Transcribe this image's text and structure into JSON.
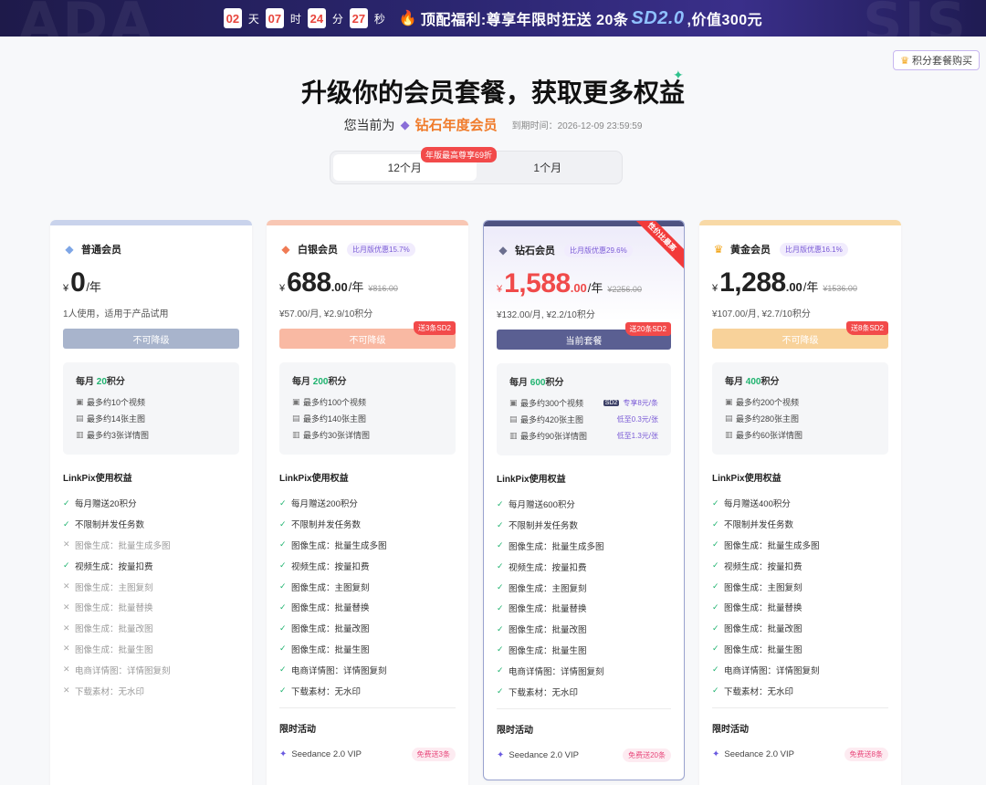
{
  "banner": {
    "countdown": [
      {
        "value": "02",
        "unit": "天"
      },
      {
        "value": "07",
        "unit": "时"
      },
      {
        "value": "24",
        "unit": "分"
      },
      {
        "value": "27",
        "unit": "秒"
      }
    ],
    "fire_icon": "fire-icon",
    "text_before": "顶配福利:尊享年限时狂送 20条",
    "highlight": "SD2.0",
    "text_after": ",价值300元"
  },
  "header": {
    "package_button": "积分套餐购买",
    "title": "升级你的会员套餐，获取更多权益",
    "current_label": "您当前为",
    "current_tier": "钻石年度会员",
    "expire": "到期时间：2026-12-09 23:59:59"
  },
  "period_tabs": {
    "items": [
      {
        "label": "12个月",
        "active": true
      },
      {
        "label": "1个月",
        "active": false
      }
    ],
    "hot_badge": "年版最高尊享69折"
  },
  "plans": [
    {
      "name": "普通会员",
      "icon": "gem-icon",
      "icon_color": "#7ea6e6",
      "discount": "",
      "currency": "¥",
      "price_int": "0",
      "price_dec": "",
      "per": "/年",
      "orig": "",
      "sub": "1人使用，适用于产品试用",
      "cta": "不可降级",
      "gift": "",
      "credits_prefix": "每月",
      "credits_num": "20",
      "credits_suffix": "积分",
      "quotas": [
        {
          "icon": "video-icon",
          "text": "最多约10个视频",
          "note": ""
        },
        {
          "icon": "image-icon",
          "text": "最多约14张主图",
          "note": ""
        },
        {
          "icon": "detail-icon",
          "text": "最多约3张详情图",
          "note": ""
        }
      ],
      "benefits_title": "LinkPix使用权益",
      "benefits": [
        {
          "text": "每月赠送20积分",
          "ok": true
        },
        {
          "text": "不限制并发任务数",
          "ok": true
        },
        {
          "text": "图像生成：批量生成多图",
          "ok": false
        },
        {
          "text": "视频生成：按量扣费",
          "ok": true
        },
        {
          "text": "图像生成：主图复刻",
          "ok": false
        },
        {
          "text": "图像生成：批量替换",
          "ok": false
        },
        {
          "text": "图像生成：批量改图",
          "ok": false
        },
        {
          "text": "图像生成：批量生图",
          "ok": false
        },
        {
          "text": "电商详情图：详情图复刻",
          "ok": false
        },
        {
          "text": "下载素材：无水印",
          "ok": false
        }
      ],
      "limited_title": "",
      "limited_item": "",
      "limited_badge": ""
    },
    {
      "name": "白银会员",
      "icon": "gem-icon",
      "icon_color": "#f07b55",
      "discount": "比月版优惠15.7%",
      "currency": "¥",
      "price_int": "688",
      "price_dec": ".00",
      "per": "/年",
      "orig": "¥816.00",
      "sub": "¥57.00/月, ¥2.9/10积分",
      "cta": "不可降级",
      "gift": "送3条SD2",
      "credits_prefix": "每月",
      "credits_num": "200",
      "credits_suffix": "积分",
      "quotas": [
        {
          "icon": "video-icon",
          "text": "最多约100个视频",
          "note": ""
        },
        {
          "icon": "image-icon",
          "text": "最多约140张主图",
          "note": ""
        },
        {
          "icon": "detail-icon",
          "text": "最多约30张详情图",
          "note": ""
        }
      ],
      "benefits_title": "LinkPix使用权益",
      "benefits": [
        {
          "text": "每月赠送200积分",
          "ok": true
        },
        {
          "text": "不限制并发任务数",
          "ok": true
        },
        {
          "text": "图像生成：批量生成多图",
          "ok": true
        },
        {
          "text": "视频生成：按量扣费",
          "ok": true
        },
        {
          "text": "图像生成：主图复刻",
          "ok": true
        },
        {
          "text": "图像生成：批量替换",
          "ok": true
        },
        {
          "text": "图像生成：批量改图",
          "ok": true
        },
        {
          "text": "图像生成：批量生图",
          "ok": true
        },
        {
          "text": "电商详情图：详情图复刻",
          "ok": true
        },
        {
          "text": "下载素材：无水印",
          "ok": true
        }
      ],
      "limited_title": "限时活动",
      "limited_item": "Seedance 2.0 VIP",
      "limited_badge": "免费送3条"
    },
    {
      "name": "钻石会员",
      "icon": "gem-icon",
      "icon_color": "#6b6f8f",
      "discount": "比月版优惠29.6%",
      "currency": "¥",
      "price_int": "1,588",
      "price_dec": ".00",
      "per": "/年",
      "orig": "¥2256.00",
      "sub": "¥132.00/月, ¥2.2/10积分",
      "cta": "当前套餐",
      "gift": "送20条SD2",
      "ribbon": "性价比最高",
      "credits_prefix": "每月",
      "credits_num": "600",
      "credits_suffix": "积分",
      "quotas": [
        {
          "icon": "video-icon",
          "text": "最多约300个视频",
          "tag": "SD2",
          "note": "专享8元/条"
        },
        {
          "icon": "image-icon",
          "text": "最多约420张主图",
          "note": "低至0.3元/张"
        },
        {
          "icon": "detail-icon",
          "text": "最多约90张详情图",
          "note": "低至1.3元/张"
        }
      ],
      "benefits_title": "LinkPix使用权益",
      "benefits": [
        {
          "text": "每月赠送600积分",
          "ok": true
        },
        {
          "text": "不限制并发任务数",
          "ok": true
        },
        {
          "text": "图像生成：批量生成多图",
          "ok": true
        },
        {
          "text": "视频生成：按量扣费",
          "ok": true
        },
        {
          "text": "图像生成：主图复刻",
          "ok": true
        },
        {
          "text": "图像生成：批量替换",
          "ok": true
        },
        {
          "text": "图像生成：批量改图",
          "ok": true
        },
        {
          "text": "图像生成：批量生图",
          "ok": true
        },
        {
          "text": "电商详情图：详情图复刻",
          "ok": true
        },
        {
          "text": "下载素材：无水印",
          "ok": true
        }
      ],
      "limited_title": "限时活动",
      "limited_item": "Seedance 2.0 VIP",
      "limited_badge": "免费送20条"
    },
    {
      "name": "黄金会员",
      "icon": "crown-icon",
      "icon_color": "#f2a51a",
      "discount": "比月版优惠16.1%",
      "currency": "¥",
      "price_int": "1,288",
      "price_dec": ".00",
      "per": "/年",
      "orig": "¥1536.00",
      "sub": "¥107.00/月, ¥2.7/10积分",
      "cta": "不可降级",
      "gift": "送8条SD2",
      "credits_prefix": "每月",
      "credits_num": "400",
      "credits_suffix": "积分",
      "quotas": [
        {
          "icon": "video-icon",
          "text": "最多约200个视频",
          "note": ""
        },
        {
          "icon": "image-icon",
          "text": "最多约280张主图",
          "note": ""
        },
        {
          "icon": "detail-icon",
          "text": "最多约60张详情图",
          "note": ""
        }
      ],
      "benefits_title": "LinkPix使用权益",
      "benefits": [
        {
          "text": "每月赠送400积分",
          "ok": true
        },
        {
          "text": "不限制并发任务数",
          "ok": true
        },
        {
          "text": "图像生成：批量生成多图",
          "ok": true
        },
        {
          "text": "视频生成：按量扣费",
          "ok": true
        },
        {
          "text": "图像生成：主图复刻",
          "ok": true
        },
        {
          "text": "图像生成：批量替换",
          "ok": true
        },
        {
          "text": "图像生成：批量改图",
          "ok": true
        },
        {
          "text": "图像生成：批量生图",
          "ok": true
        },
        {
          "text": "电商详情图：详情图复刻",
          "ok": true
        },
        {
          "text": "下载素材：无水印",
          "ok": true
        }
      ],
      "limited_title": "限时活动",
      "limited_item": "Seedance 2.0 VIP",
      "limited_badge": "免费送8条"
    }
  ],
  "colors": {
    "plan_bars": [
      "#c9d3ec",
      "#f8c7b4",
      "#4e5281",
      "#f8d9a6"
    ],
    "cta_backgrounds": [
      "#a8b4cc",
      "#f9b9a3",
      "#5a5f92",
      "#f8d29a"
    ]
  }
}
